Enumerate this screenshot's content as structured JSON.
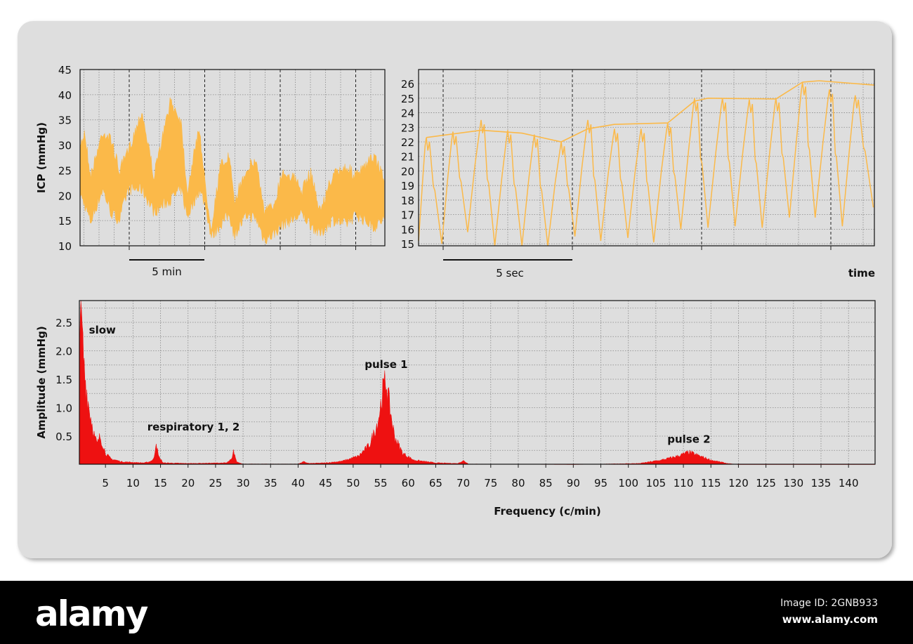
{
  "chart_data": [
    {
      "type": "area",
      "title": "",
      "ylabel": "ICP (mmHg)",
      "xlabel": "",
      "ylim": [
        10,
        45
      ],
      "yticks": [
        10,
        15,
        20,
        25,
        30,
        35,
        40,
        45
      ],
      "xunit": "min",
      "xlim": [
        0,
        20.2
      ],
      "scale_bar_label": "5 min",
      "color": "#fbb949",
      "envelope": {
        "t": [
          0,
          0.3,
          0.7,
          1.5,
          2.1,
          2.6,
          3.2,
          4.1,
          4.9,
          6.0,
          6.7,
          7.1,
          7.9,
          8.3,
          8.7,
          9.3,
          9.9,
          10.2,
          11.1,
          11.7,
          12.2,
          12.8,
          13.4,
          14.1,
          14.7,
          15.3,
          15.9,
          16.7,
          17.6,
          18.3,
          19.5,
          20.1
        ],
        "upper": [
          31,
          34,
          25,
          34,
          32,
          26,
          30,
          38,
          25,
          40,
          36,
          22,
          35,
          23,
          15,
          27,
          29,
          20,
          27,
          28,
          18,
          19,
          26,
          25,
          22,
          26,
          18,
          25,
          27,
          25,
          29,
          25
        ],
        "lower": [
          19,
          17,
          13.5,
          20,
          15,
          14,
          20,
          20,
          15.5,
          18,
          20,
          14.5,
          20,
          17,
          10.5,
          13,
          15,
          11,
          15,
          14,
          10,
          11,
          13,
          14,
          15,
          13,
          11,
          14,
          13,
          15,
          12.5,
          14
        ]
      }
    },
    {
      "type": "line",
      "title": "",
      "xlabel": "time",
      "ylabel": "",
      "ylim": [
        14.86,
        26.97
      ],
      "yticks": [
        15,
        16,
        17,
        18,
        19,
        20,
        21,
        22,
        23,
        24,
        25,
        26
      ],
      "xunit": "sec",
      "xlim": [
        0,
        17.64
      ],
      "scale_bar_label": "5 sec",
      "color": "#fbb949",
      "peaks": {
        "t": [
          0.3,
          1.33,
          2.42,
          3.45,
          4.48,
          5.52,
          6.55,
          7.58,
          8.61,
          9.64,
          10.68,
          11.76,
          12.8,
          13.83,
          14.86,
          15.9,
          16.9
        ],
        "v": [
          22.3,
          22.7,
          23.5,
          22.8,
          22.5,
          22.0,
          23.5,
          22.9,
          22.9,
          23.3,
          25.0,
          25.0,
          24.9,
          25.0,
          26.1,
          25.6,
          25.2
        ]
      },
      "troughs": {
        "t": [
          0.9,
          1.9,
          2.95,
          4.0,
          5.0,
          6.05,
          7.05,
          8.1,
          9.1,
          10.15,
          11.2,
          12.25,
          13.3,
          14.35,
          15.35,
          16.4,
          17.6
        ],
        "v": [
          15.0,
          15.8,
          14.8,
          14.8,
          14.8,
          15.5,
          15.2,
          15.4,
          15.1,
          16.0,
          16.1,
          16.2,
          16.1,
          16.8,
          16.8,
          16.2,
          17.5
        ]
      },
      "envelope": {
        "t": [
          0.3,
          2.42,
          4.0,
          5.52,
          6.55,
          7.58,
          9.64,
          10.68,
          11.2,
          13.83,
          14.86,
          15.5,
          17.64
        ],
        "v": [
          22.3,
          22.8,
          22.6,
          22.0,
          22.9,
          23.2,
          23.3,
          24.8,
          25.0,
          24.95,
          26.1,
          26.2,
          25.9
        ]
      }
    },
    {
      "type": "area",
      "title": "",
      "xlabel": "Frequency (c/min)",
      "ylabel": "Amplitude (mmHg)",
      "xlim": [
        0.25,
        144.8
      ],
      "ylim": [
        0,
        2.88
      ],
      "xticks": [
        5,
        10,
        15,
        20,
        25,
        30,
        35,
        40,
        45,
        50,
        55,
        60,
        65,
        70,
        75,
        80,
        85,
        90,
        95,
        100,
        105,
        110,
        115,
        120,
        125,
        130,
        135,
        140
      ],
      "yticks": [
        0.5,
        1.0,
        1.5,
        2.0,
        2.5
      ],
      "ytick_labels": [
        "0.5",
        "1.0",
        "1.5",
        "2.0",
        "2.5"
      ],
      "color": "#ee1111",
      "x": [
        0.3,
        0.5,
        0.8,
        1.2,
        2,
        3,
        3.5,
        4,
        5,
        6,
        8,
        12,
        13,
        13.8,
        14.2,
        14.6,
        15.5,
        20,
        27,
        28,
        28.3,
        28.8,
        30,
        40,
        41,
        42,
        45,
        48,
        51,
        53,
        54.5,
        55.5,
        56,
        56.5,
        57.5,
        59,
        61,
        65,
        69,
        70,
        71,
        90,
        102,
        106,
        109,
        111,
        113,
        115,
        118,
        120,
        144.8
      ],
      "y": [
        2.6,
        2.9,
        2.2,
        1.6,
        1.0,
        0.5,
        0.35,
        0.5,
        0.2,
        0.1,
        0.05,
        0.03,
        0.05,
        0.1,
        0.42,
        0.15,
        0.03,
        0.02,
        0.03,
        0.1,
        0.25,
        0.05,
        0.01,
        0.01,
        0.05,
        0.02,
        0.03,
        0.06,
        0.15,
        0.35,
        0.75,
        1.35,
        1.48,
        1.1,
        0.5,
        0.2,
        0.08,
        0.03,
        0.02,
        0.07,
        0.01,
        0,
        0.02,
        0.08,
        0.15,
        0.22,
        0.15,
        0.08,
        0.02,
        0,
        0
      ],
      "annotations": [
        {
          "text": "slow",
          "x": 2,
          "y": 2.3
        },
        {
          "text": "respiratory 1, 2",
          "x": 21,
          "y": 0.6
        },
        {
          "text": "pulse 1",
          "x": 56,
          "y": 1.7
        },
        {
          "text": "pulse 2",
          "x": 111,
          "y": 0.38
        }
      ]
    }
  ],
  "footer": {
    "logo": "alamy",
    "image_id": "Image ID: 2GNB933",
    "site": "www.alamy.com"
  }
}
